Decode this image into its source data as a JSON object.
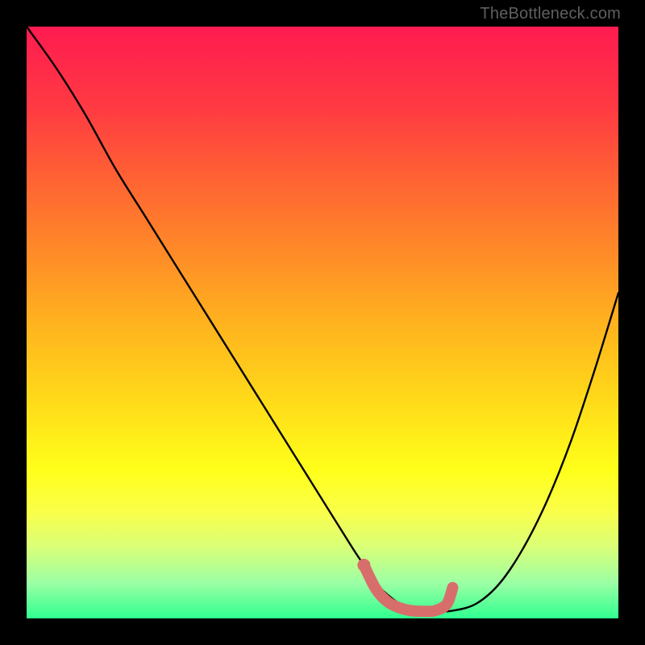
{
  "credit": "TheBottleneck.com",
  "chart_data": {
    "type": "line",
    "title": "",
    "xlabel": "",
    "ylabel": "",
    "xlim": [
      0,
      100
    ],
    "ylim": [
      0,
      100
    ],
    "series": [
      {
        "name": "bottleneck-curve",
        "x": [
          0,
          5,
          10,
          15,
          20,
          25,
          30,
          35,
          40,
          45,
          50,
          55,
          57,
          59,
          61,
          63,
          65,
          67,
          69,
          72,
          76,
          80,
          84,
          88,
          92,
          96,
          100
        ],
        "y": [
          100,
          93,
          85,
          76,
          68,
          60,
          52,
          44,
          36,
          28,
          20,
          12,
          9,
          6,
          4,
          2.5,
          1.5,
          1.3,
          1.2,
          1.3,
          2.5,
          6,
          12,
          20,
          30,
          42,
          55
        ]
      }
    ],
    "highlight": {
      "name": "optimal-range",
      "x": [
        57,
        59,
        61,
        63,
        65,
        67,
        69,
        71,
        72
      ],
      "y": [
        9.0,
        5.0,
        2.8,
        1.8,
        1.3,
        1.2,
        1.3,
        2.4,
        5.2
      ],
      "color": "#d86e6b"
    },
    "background_gradient_stops": [
      {
        "pos": 0.0,
        "color": "#ff1b50"
      },
      {
        "pos": 0.25,
        "color": "#ff6034"
      },
      {
        "pos": 0.5,
        "color": "#ffb21e"
      },
      {
        "pos": 0.75,
        "color": "#ffff1a"
      },
      {
        "pos": 1.0,
        "color": "#2fff90"
      }
    ]
  }
}
